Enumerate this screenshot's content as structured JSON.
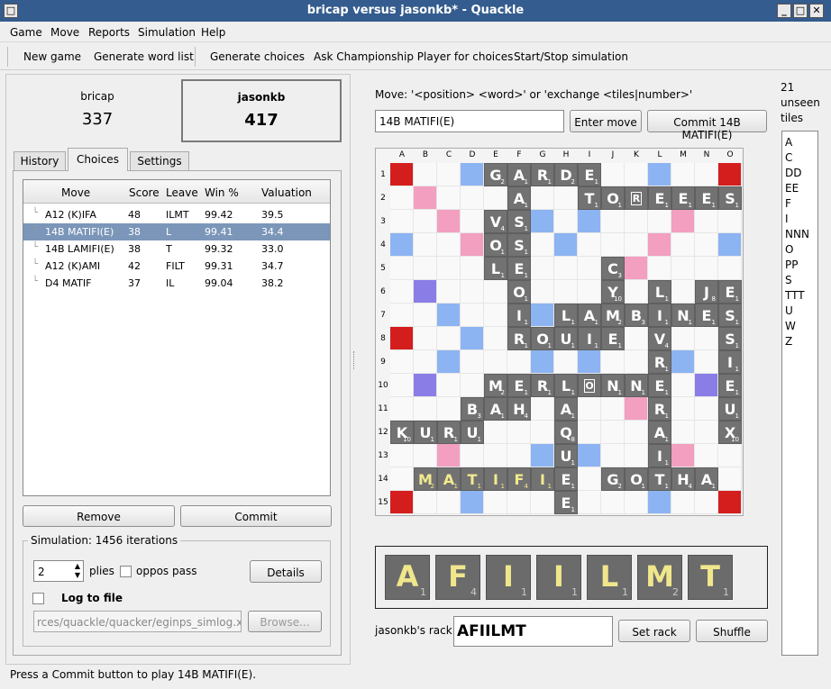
{
  "window": {
    "title": "bricap versus jasonkb* - Quackle"
  },
  "menu": [
    "Game",
    "Move",
    "Reports",
    "Simulation",
    "Help"
  ],
  "toolbar": [
    "New game",
    "Generate word list",
    "Generate choices",
    "Ask Championship Player for choices",
    "Start/Stop simulation"
  ],
  "players": [
    {
      "name": "bricap",
      "score": "337"
    },
    {
      "name": "jasonkb",
      "score": "417"
    }
  ],
  "tabs": [
    "History",
    "Choices",
    "Settings"
  ],
  "choices": {
    "headers": [
      "Move",
      "Score",
      "Leave",
      "Win %",
      "Valuation"
    ],
    "rows": [
      [
        "A12 (K)IFA",
        "48",
        "ILMT",
        "99.42",
        "39.5"
      ],
      [
        "14B MATIFI(E)",
        "38",
        "L",
        "99.41",
        "34.4"
      ],
      [
        "14B LAMIFI(E)",
        "38",
        "T",
        "99.32",
        "33.0"
      ],
      [
        "A12 (K)AMI",
        "42",
        "FILT",
        "99.31",
        "34.7"
      ],
      [
        "D4 MATIF",
        "37",
        "IL",
        "99.04",
        "38.2"
      ]
    ],
    "selected_index": 1,
    "remove_label": "Remove",
    "commit_label": "Commit"
  },
  "simulation": {
    "label": "Simulation: 1456 iterations",
    "plies_value": "2",
    "plies_label": "plies",
    "oppos_pass_label": "oppos pass",
    "details_label": "Details",
    "log_label": "Log to file",
    "log_path": "rces/quackle/quacker/eginps_simlog.xml",
    "browse_label": "Browse..."
  },
  "move_entry": {
    "label": "Move: '<position> <word>' or 'exchange <tiles|number>'",
    "value": "14B MATIFI(E)",
    "enter_label": "Enter move",
    "commit_label": "Commit 14B MATIFI(E)"
  },
  "board": {
    "columns": [
      "A",
      "B",
      "C",
      "D",
      "E",
      "F",
      "G",
      "H",
      "I",
      "J",
      "K",
      "L",
      "M",
      "N",
      "O"
    ],
    "rows": [
      "1",
      "2",
      "3",
      "4",
      "5",
      "6",
      "7",
      "8",
      "9",
      "10",
      "11",
      "12",
      "13",
      "14",
      "15"
    ],
    "tiles": [
      {
        "r": 1,
        "c": 5,
        "l": "G",
        "v": "2"
      },
      {
        "r": 1,
        "c": 6,
        "l": "A",
        "v": "1"
      },
      {
        "r": 1,
        "c": 7,
        "l": "R",
        "v": "1"
      },
      {
        "r": 1,
        "c": 8,
        "l": "D",
        "v": "2"
      },
      {
        "r": 1,
        "c": 9,
        "l": "E",
        "v": "1"
      },
      {
        "r": 2,
        "c": 6,
        "l": "A",
        "v": "1"
      },
      {
        "r": 2,
        "c": 9,
        "l": "T",
        "v": "1"
      },
      {
        "r": 2,
        "c": 10,
        "l": "O",
        "v": "1"
      },
      {
        "r": 2,
        "c": 11,
        "l": "R",
        "v": "",
        "blank": true
      },
      {
        "r": 2,
        "c": 12,
        "l": "E",
        "v": "1"
      },
      {
        "r": 2,
        "c": 13,
        "l": "E",
        "v": "1"
      },
      {
        "r": 2,
        "c": 14,
        "l": "E",
        "v": "1"
      },
      {
        "r": 2,
        "c": 15,
        "l": "S",
        "v": "1"
      },
      {
        "r": 3,
        "c": 5,
        "l": "V",
        "v": "4"
      },
      {
        "r": 3,
        "c": 6,
        "l": "S",
        "v": "1"
      },
      {
        "r": 4,
        "c": 5,
        "l": "O",
        "v": "1"
      },
      {
        "r": 4,
        "c": 6,
        "l": "S",
        "v": "1"
      },
      {
        "r": 5,
        "c": 5,
        "l": "L",
        "v": "1"
      },
      {
        "r": 5,
        "c": 6,
        "l": "E",
        "v": "1"
      },
      {
        "r": 5,
        "c": 10,
        "l": "C",
        "v": "3"
      },
      {
        "r": 6,
        "c": 6,
        "l": "O",
        "v": "1"
      },
      {
        "r": 6,
        "c": 10,
        "l": "Y",
        "v": "10"
      },
      {
        "r": 6,
        "c": 12,
        "l": "L",
        "v": "1"
      },
      {
        "r": 6,
        "c": 14,
        "l": "J",
        "v": "8"
      },
      {
        "r": 6,
        "c": 15,
        "l": "E",
        "v": "1"
      },
      {
        "r": 7,
        "c": 6,
        "l": "I",
        "v": "1"
      },
      {
        "r": 7,
        "c": 8,
        "l": "L",
        "v": "1"
      },
      {
        "r": 7,
        "c": 9,
        "l": "A",
        "v": "1"
      },
      {
        "r": 7,
        "c": 10,
        "l": "M",
        "v": "2"
      },
      {
        "r": 7,
        "c": 11,
        "l": "B",
        "v": "3"
      },
      {
        "r": 7,
        "c": 12,
        "l": "I",
        "v": "1"
      },
      {
        "r": 7,
        "c": 13,
        "l": "N",
        "v": "1"
      },
      {
        "r": 7,
        "c": 14,
        "l": "E",
        "v": "1"
      },
      {
        "r": 7,
        "c": 15,
        "l": "S",
        "v": "1"
      },
      {
        "r": 8,
        "c": 6,
        "l": "R",
        "v": "1"
      },
      {
        "r": 8,
        "c": 7,
        "l": "O",
        "v": "1"
      },
      {
        "r": 8,
        "c": 8,
        "l": "U",
        "v": "1"
      },
      {
        "r": 8,
        "c": 9,
        "l": "I",
        "v": "1"
      },
      {
        "r": 8,
        "c": 10,
        "l": "E",
        "v": "1"
      },
      {
        "r": 8,
        "c": 12,
        "l": "V",
        "v": "4"
      },
      {
        "r": 8,
        "c": 15,
        "l": "S",
        "v": "1"
      },
      {
        "r": 9,
        "c": 12,
        "l": "R",
        "v": "1"
      },
      {
        "r": 9,
        "c": 15,
        "l": "I",
        "v": "1"
      },
      {
        "r": 10,
        "c": 5,
        "l": "M",
        "v": "2"
      },
      {
        "r": 10,
        "c": 6,
        "l": "E",
        "v": "1"
      },
      {
        "r": 10,
        "c": 7,
        "l": "R",
        "v": "1"
      },
      {
        "r": 10,
        "c": 8,
        "l": "L",
        "v": "1"
      },
      {
        "r": 10,
        "c": 9,
        "l": "O",
        "v": "",
        "blank": true
      },
      {
        "r": 10,
        "c": 10,
        "l": "N",
        "v": "1"
      },
      {
        "r": 10,
        "c": 11,
        "l": "N",
        "v": "1"
      },
      {
        "r": 10,
        "c": 12,
        "l": "E",
        "v": "1"
      },
      {
        "r": 10,
        "c": 15,
        "l": "E",
        "v": "1"
      },
      {
        "r": 11,
        "c": 4,
        "l": "B",
        "v": "3"
      },
      {
        "r": 11,
        "c": 5,
        "l": "A",
        "v": "1"
      },
      {
        "r": 11,
        "c": 6,
        "l": "H",
        "v": "4"
      },
      {
        "r": 11,
        "c": 8,
        "l": "A",
        "v": "1"
      },
      {
        "r": 11,
        "c": 12,
        "l": "R",
        "v": "1"
      },
      {
        "r": 11,
        "c": 15,
        "l": "U",
        "v": "1"
      },
      {
        "r": 12,
        "c": 1,
        "l": "K",
        "v": "10"
      },
      {
        "r": 12,
        "c": 2,
        "l": "U",
        "v": "1"
      },
      {
        "r": 12,
        "c": 3,
        "l": "R",
        "v": "1"
      },
      {
        "r": 12,
        "c": 4,
        "l": "U",
        "v": "1"
      },
      {
        "r": 12,
        "c": 8,
        "l": "Q",
        "v": "8"
      },
      {
        "r": 12,
        "c": 12,
        "l": "A",
        "v": "1"
      },
      {
        "r": 12,
        "c": 15,
        "l": "X",
        "v": "10"
      },
      {
        "r": 13,
        "c": 8,
        "l": "U",
        "v": "1"
      },
      {
        "r": 13,
        "c": 12,
        "l": "I",
        "v": "1"
      },
      {
        "r": 14,
        "c": 2,
        "l": "M",
        "v": "2",
        "p": true
      },
      {
        "r": 14,
        "c": 3,
        "l": "A",
        "v": "1",
        "p": true
      },
      {
        "r": 14,
        "c": 4,
        "l": "T",
        "v": "1",
        "p": true
      },
      {
        "r": 14,
        "c": 5,
        "l": "I",
        "v": "1",
        "p": true
      },
      {
        "r": 14,
        "c": 6,
        "l": "F",
        "v": "4",
        "p": true
      },
      {
        "r": 14,
        "c": 7,
        "l": "I",
        "v": "1",
        "p": true
      },
      {
        "r": 14,
        "c": 8,
        "l": "E",
        "v": "1"
      },
      {
        "r": 14,
        "c": 10,
        "l": "G",
        "v": "2"
      },
      {
        "r": 14,
        "c": 11,
        "l": "O",
        "v": "1"
      },
      {
        "r": 14,
        "c": 12,
        "l": "T",
        "v": "1"
      },
      {
        "r": 14,
        "c": 13,
        "l": "H",
        "v": "4"
      },
      {
        "r": 14,
        "c": 14,
        "l": "A",
        "v": "1"
      },
      {
        "r": 15,
        "c": 8,
        "l": "E",
        "v": "1"
      }
    ]
  },
  "rack": {
    "tiles": [
      {
        "l": "A",
        "v": "1"
      },
      {
        "l": "F",
        "v": "4"
      },
      {
        "l": "I",
        "v": "1"
      },
      {
        "l": "I",
        "v": "1"
      },
      {
        "l": "L",
        "v": "1"
      },
      {
        "l": "M",
        "v": "2"
      },
      {
        "l": "T",
        "v": "1"
      }
    ],
    "label": "jasonkb's rack:",
    "value": "AFIILMT",
    "set_label": "Set rack",
    "shuffle_label": "Shuffle"
  },
  "unseen": {
    "count": "21",
    "word1": "unseen",
    "word2": "tiles",
    "tiles": [
      "A",
      "C",
      "DD",
      "EE",
      "F",
      "I",
      "NNN",
      "O",
      "PP",
      "S",
      "TTT",
      "U",
      "W",
      "Z"
    ]
  },
  "status": "Press a Commit button to play 14B MATIFI(E).",
  "colors": {
    "triple_word": "#d41d1d",
    "double_word": "#f29fc0",
    "triple_letter": "#8a7de6",
    "double_letter": "#8cb4f2",
    "played": "#f2ea8f",
    "selection": "#7b96b8",
    "title": "#345c8e"
  }
}
